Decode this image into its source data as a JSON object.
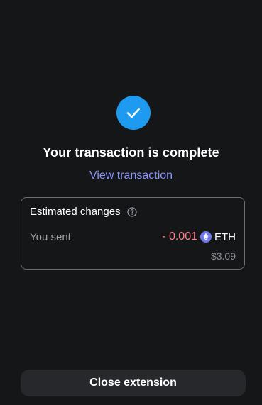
{
  "status": {
    "icon": "checkmark-icon",
    "title": "Your transaction is complete",
    "view_link": "View transaction"
  },
  "estimated_changes": {
    "title": "Estimated changes",
    "help_icon": "question-circle-icon",
    "row": {
      "label": "You sent",
      "amount": "- 0.001",
      "token_icon": "eth-icon",
      "token_symbol": "ETH",
      "fiat_value": "$3.09"
    }
  },
  "footer": {
    "close_label": "Close extension"
  },
  "colors": {
    "background": "#141618",
    "accent_blue": "#1e9bf0",
    "link": "#8a93ff",
    "negative_amount": "#ff7b8a",
    "card_border": "#6a6e74",
    "button_bg": "#26282c"
  }
}
